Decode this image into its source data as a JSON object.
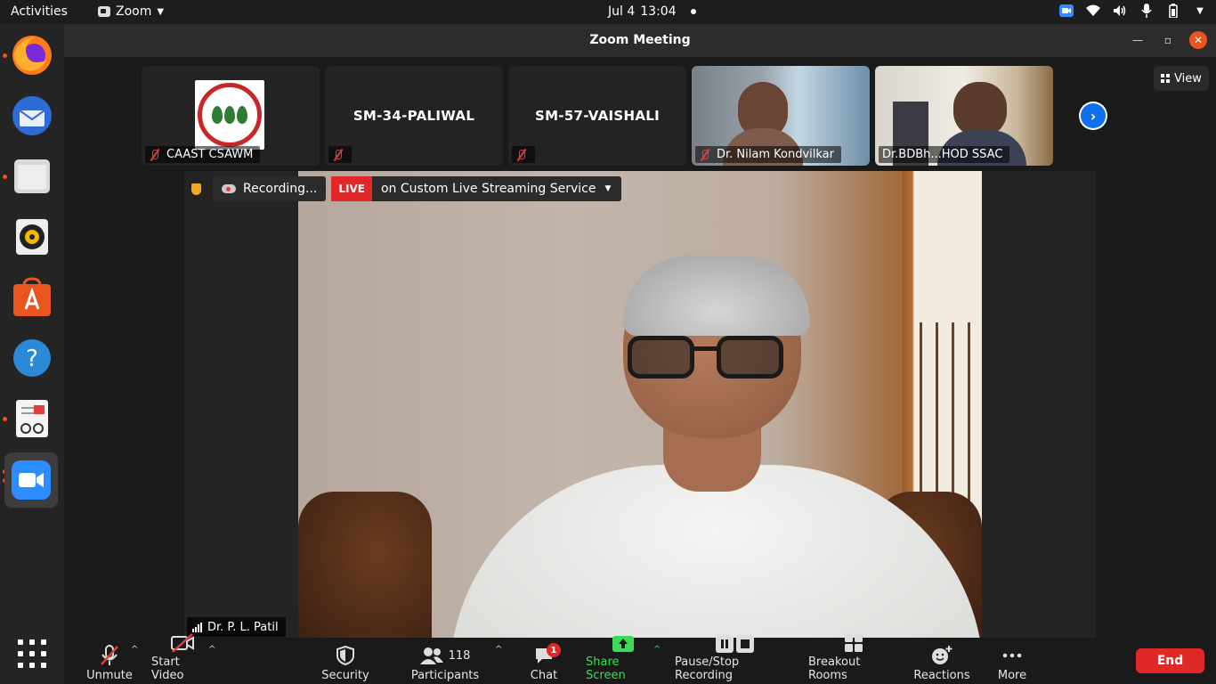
{
  "topbar": {
    "activities": "Activities",
    "app_name": "Zoom",
    "date": "Jul 4",
    "time": "13:04"
  },
  "window": {
    "title": "Zoom Meeting"
  },
  "thumbnails": [
    {
      "name": "",
      "label": "CAAST CSAWM"
    },
    {
      "name": "SM-34-PALIWAL",
      "label": ""
    },
    {
      "name": "SM-57-VAISHALI",
      "label": ""
    },
    {
      "name": "",
      "label": "Dr. Nilam Kondvilkar"
    },
    {
      "name": "",
      "label": "Dr.BDBh...HOD SSAC"
    }
  ],
  "view_button": "View",
  "recording": {
    "status": "Recording...",
    "live": "LIVE",
    "service": "on Custom Live Streaming Service"
  },
  "speaker": {
    "name": "Dr. P. L. Patil"
  },
  "toolbar": {
    "unmute": "Unmute",
    "start_video": "Start Video",
    "security": "Security",
    "participants": "Participants",
    "participants_count": "118",
    "chat": "Chat",
    "chat_badge": "1",
    "share_screen": "Share Screen",
    "pause_recording": "Pause/Stop Recording",
    "breakout_rooms": "Breakout Rooms",
    "reactions": "Reactions",
    "more": "More",
    "end": "End"
  },
  "colors": {
    "end": "#e02828",
    "share": "#3ddb5a",
    "accent": "#0e71eb",
    "ubuntu_orange": "#e95420"
  }
}
